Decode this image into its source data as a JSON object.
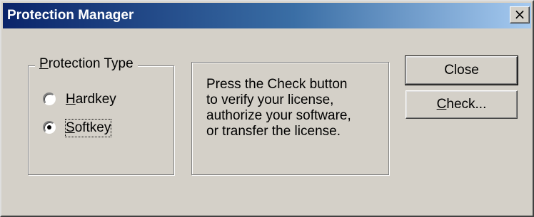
{
  "window": {
    "title": "Protection Manager",
    "close_glyph": "×"
  },
  "protection_type": {
    "legend_mnemonic": "P",
    "legend_rest": "rotection Type",
    "options": [
      {
        "mnemonic": "H",
        "rest": "ardkey",
        "checked": false
      },
      {
        "mnemonic": "S",
        "rest": "oftkey",
        "checked": true
      }
    ]
  },
  "info": {
    "lines": [
      "Press the Check button",
      "to verify your license,",
      "authorize your software,",
      "or transfer the license."
    ]
  },
  "buttons": {
    "close_label": "Close",
    "check_mnemonic": "C",
    "check_rest": "heck..."
  }
}
